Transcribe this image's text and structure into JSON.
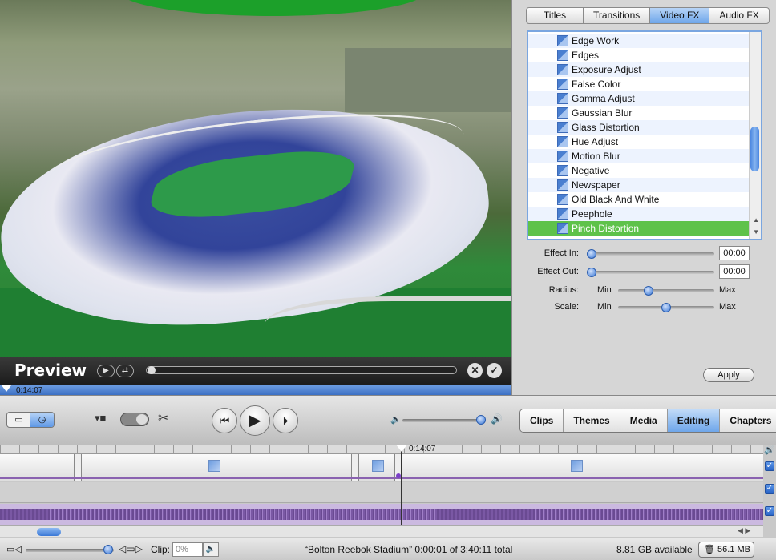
{
  "preview": {
    "label": "Preview",
    "timecode": "0:14:07",
    "play_icon": "▶",
    "loop_icon": "⇄",
    "cancel_icon": "✕",
    "done_icon": "✓"
  },
  "fx_panel": {
    "tabs": [
      "Titles",
      "Transitions",
      "Video FX",
      "Audio FX"
    ],
    "active_tab": "Video FX",
    "effects": [
      "Edge Work",
      "Edges",
      "Exposure Adjust",
      "False Color",
      "Gamma Adjust",
      "Gaussian Blur",
      "Glass Distortion",
      "Hue Adjust",
      "Motion Blur",
      "Negative",
      "Newspaper",
      "Old Black And White",
      "Peephole",
      "Pinch Distortion"
    ],
    "selected_effect": "Pinch Distortion",
    "params": {
      "effect_in_label": "Effect In:",
      "effect_in_value": "00:00",
      "effect_out_label": "Effect Out:",
      "effect_out_value": "00:00",
      "radius_label": "Radius:",
      "scale_label": "Scale:",
      "min_label": "Min",
      "max_label": "Max",
      "radius_level": 0.32,
      "scale_level": 0.5
    },
    "apply_label": "Apply"
  },
  "toolbar": {
    "scissors_icon": "✂",
    "rewind_icon": "⏮",
    "play_icon": "▶",
    "fullscreen_play_icon": "⏵",
    "volume_low_icon": "🔈",
    "volume_high_icon": "🔊",
    "volume_level": 0.92,
    "mode_tabs": [
      "Clips",
      "Themes",
      "Media",
      "Editing",
      "Chapters"
    ],
    "active_mode": "Editing"
  },
  "timeline": {
    "playhead_time": "0:14:07",
    "speaker_icon": "🔊",
    "check_icon": "✓"
  },
  "statusbar": {
    "clip_label": "Clip:",
    "clip_volume_placeholder": "0%",
    "project_status": "“Bolton Reebok Stadium”  0:00:01 of 3:40:11 total",
    "disk_available": "8.81 GB available",
    "trash_size": "56.1 MB"
  },
  "colors": {
    "accent_blue": "#6ea6ea",
    "selection_green": "#5ec24a",
    "audio_purple": "#7a58a4"
  }
}
